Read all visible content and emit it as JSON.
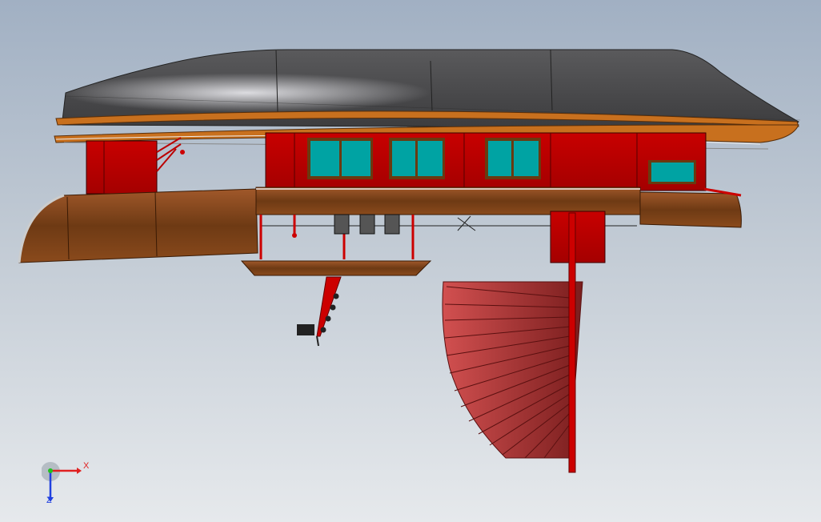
{
  "viewport": {
    "background_top": "#a1b0c3",
    "background_bottom": "#e6e9ec"
  },
  "model": {
    "colors": {
      "roof": "#4a4a4a",
      "roof_highlight": "#d8d8dc",
      "trim": "#c86a1e",
      "body_red": "#c00000",
      "wood": "#8a4a1c",
      "window": "#00a3a3",
      "fan": "#b03a3a"
    }
  },
  "triad": {
    "x_label": "X",
    "z_label": "Z",
    "x_color": "#e02020",
    "z_color": "#2040e0",
    "y_color": "#20c020"
  }
}
